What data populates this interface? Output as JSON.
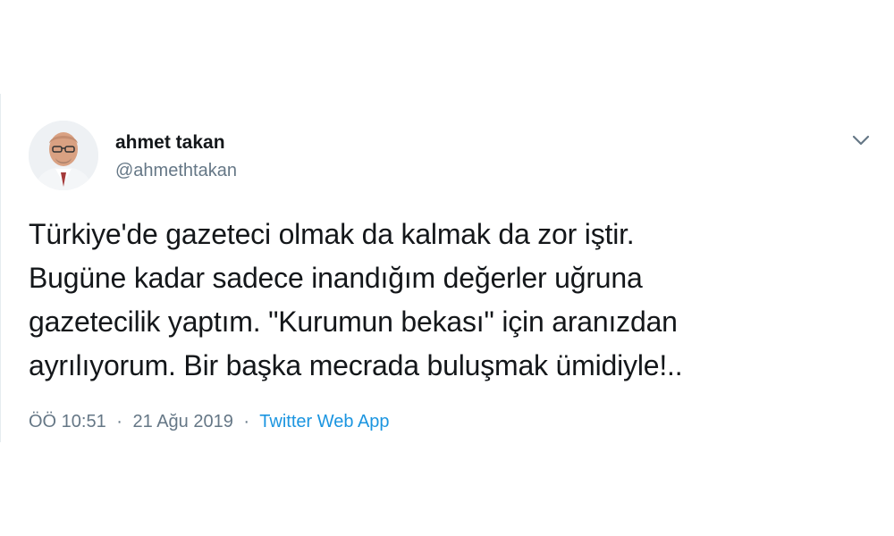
{
  "tweet": {
    "author": {
      "name": "ahmet takan",
      "handle": "@ahmethtakan"
    },
    "text_lines": [
      "Türkiye'de gazeteci olmak da kalmak da zor iştir.",
      "Bugüne kadar sadece inandığım değerler uğruna",
      "gazetecilik yaptım. \"Kurumun bekası\" için aranızdan",
      "ayrılıyorum. Bir başka mecrada buluşmak ümidiyle!.."
    ],
    "time": "ÖÖ 10:51",
    "date": "21 Ağu 2019",
    "separator": "·",
    "source": "Twitter Web App",
    "menu_icon": "chevron-down-icon"
  },
  "colors": {
    "text": "#14171a",
    "secondary": "#657786",
    "link": "#1b95e0"
  }
}
